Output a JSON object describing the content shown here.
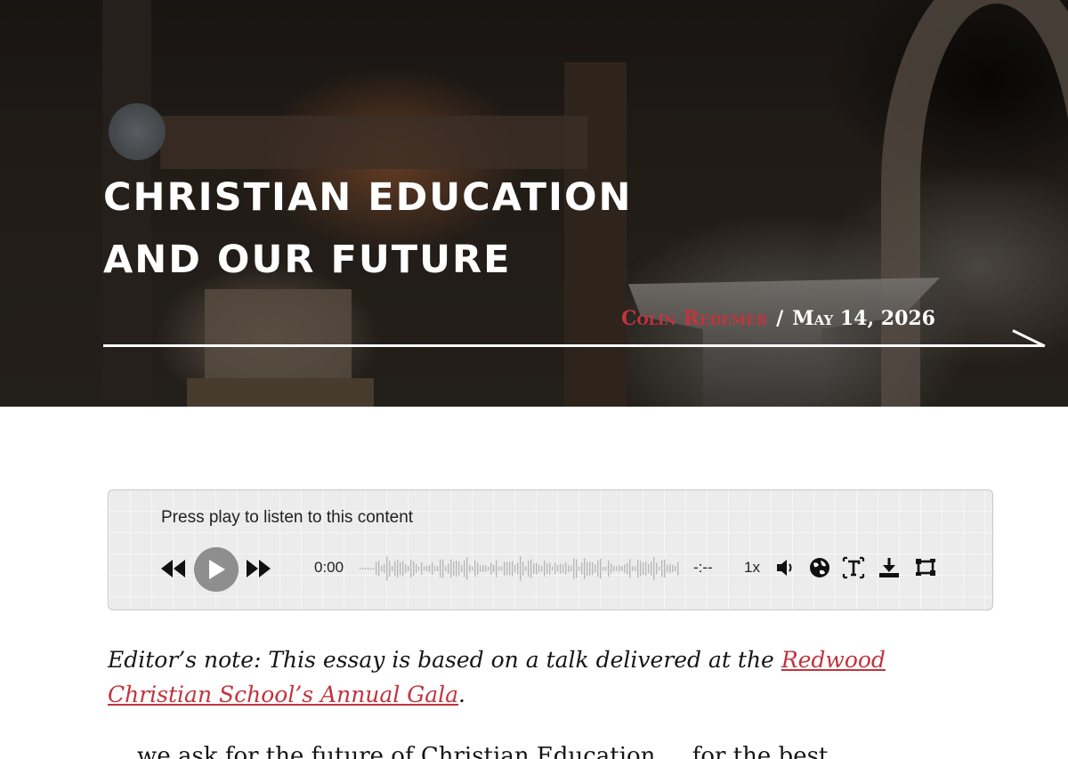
{
  "hero": {
    "title": "Christian Education and Our Future",
    "author": "Colin Redemer",
    "separator": "/",
    "date": "May 14, 2026"
  },
  "player": {
    "prompt": "Press play to listen to this content",
    "current_time": "0:00",
    "total_time": "-:--",
    "speed": "1x"
  },
  "article": {
    "note_prefix": "Editor’s note: This essay is based on a talk delivered at the ",
    "note_link": "Redwood Christian School’s Annual Gala",
    "note_suffix": ".",
    "body_fragment": "... we ask for the future of Christian Education ... for the best ..."
  },
  "colors": {
    "accent": "#c2343d",
    "player_bg": "#ececec",
    "play_button": "#8e8e8e"
  }
}
